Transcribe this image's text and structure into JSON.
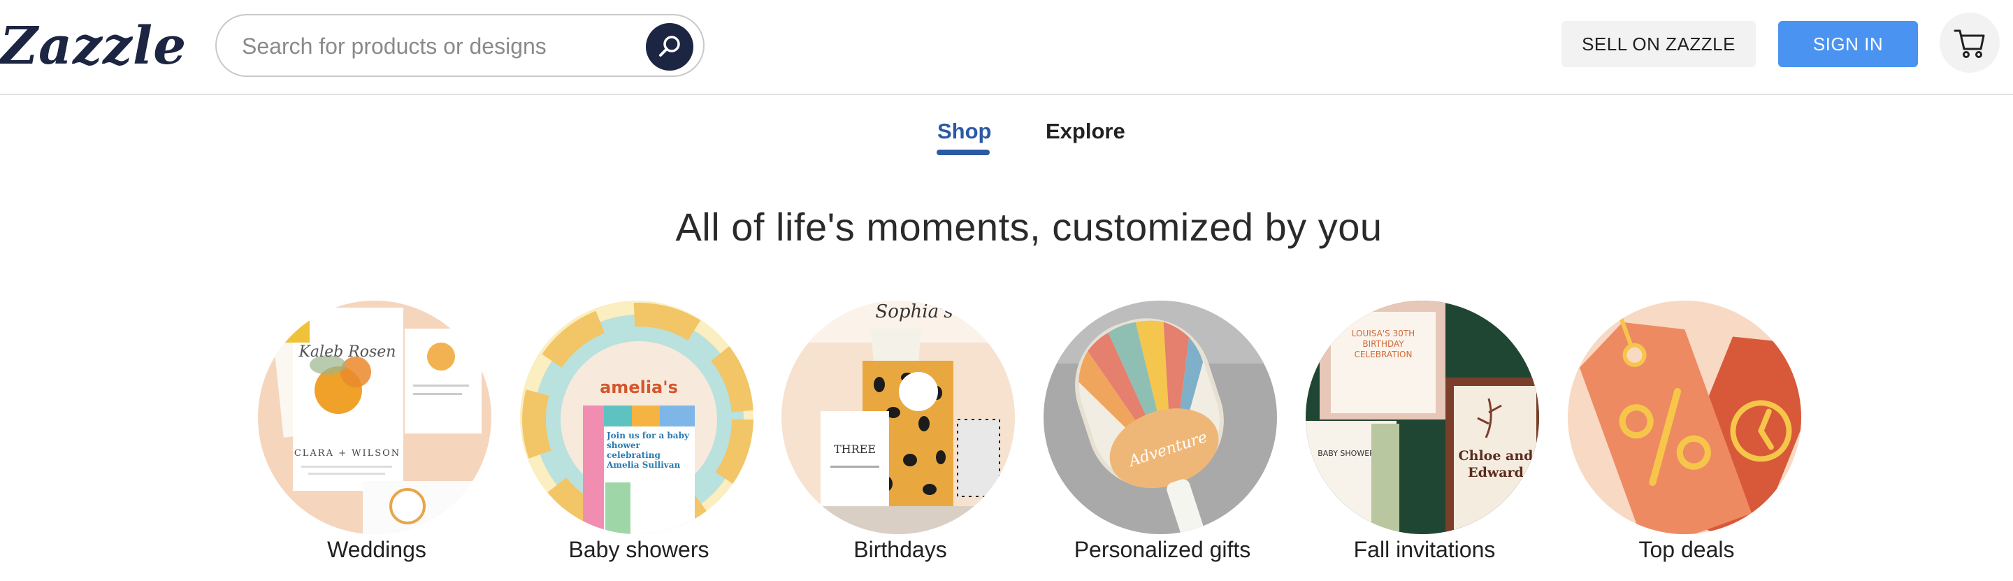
{
  "header": {
    "logo": "Zazzle",
    "search_placeholder": "Search for products or designs",
    "sell_label": "SELL ON ZAZZLE",
    "signin_label": "SIGN IN",
    "cart_icon": "cart-icon"
  },
  "tabs": [
    {
      "label": "Shop",
      "active": true
    },
    {
      "label": "Explore",
      "active": false
    }
  ],
  "headline": "All of life's moments, customized by you",
  "categories": [
    {
      "label": "Weddings"
    },
    {
      "label": "Baby showers"
    },
    {
      "label": "Birthdays"
    },
    {
      "label": "Personalized gifts"
    },
    {
      "label": "Fall invitations"
    },
    {
      "label": "Top deals"
    }
  ],
  "thumb_text": {
    "wedding_couple": "CLARA + WILSON",
    "wedding_script": "Kaleb Rosen",
    "baby_name": "amelia's",
    "baby_card": "Join us for a baby shower celebrating Amelia Sullivan",
    "birthday_name": "Sophia's",
    "birthday_card": "THREE",
    "paddle_script": "Adventure",
    "fall_card_1": "LOUISA'S 30TH BIRTHDAY CELEBRATION",
    "fall_card_2": "Chloe and Edward",
    "fall_card_3": "BABY SHOWER"
  },
  "colors": {
    "brand_navy": "#1c2541",
    "accent_blue": "#4a93f0",
    "tab_active": "#2b5aa5"
  }
}
